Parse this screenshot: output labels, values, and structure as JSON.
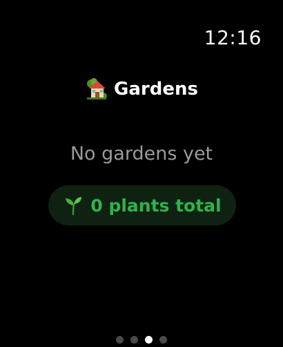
{
  "status": {
    "time": "12:16"
  },
  "header": {
    "title": "Gardens",
    "icon": "house-with-garden-icon"
  },
  "empty_state": {
    "message": "No gardens yet"
  },
  "summary": {
    "icon": "seedling-icon",
    "label": "0 plants total",
    "accent_color": "#2fb34a"
  },
  "pager": {
    "page_count": 4,
    "active_index": 2
  }
}
